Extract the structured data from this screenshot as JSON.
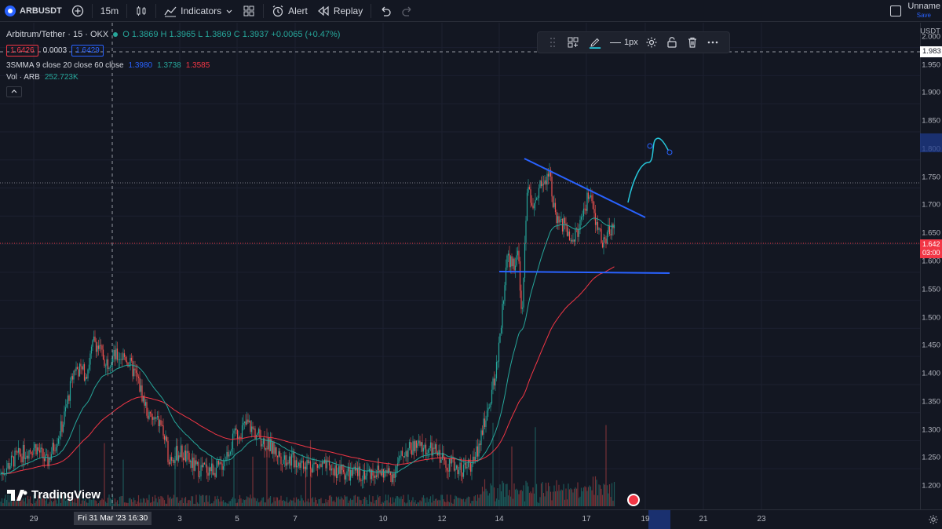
{
  "toolbar": {
    "symbol": "ARBUSDT",
    "interval": "15m",
    "indicators_label": "Indicators",
    "alert_label": "Alert",
    "replay_label": "Replay",
    "layout_name": "Unname",
    "layout_save": "Save"
  },
  "legend": {
    "title": "Arbitrum/Tether · 15 · OKX",
    "ohlc": "O 1.3869 H 1.3965 L 1.3869 C 1.3937 +0.0065 (+0.47%)",
    "bid": "1.6426",
    "spread": "0.0003",
    "ask": "1.6429",
    "ma_name": "3SMMA 9 close 20 close 60 close",
    "ma_val1": "1.3980",
    "ma_val2": "1.3738",
    "ma_val3": "1.3585",
    "vol_name": "Vol · ARB",
    "vol_value": "252.723K"
  },
  "draw_toolbar": {
    "width_label": "1px"
  },
  "price_axis": {
    "currency": "USDT",
    "labels": [
      "2.000",
      "1.950",
      "1.900",
      "1.850",
      "1.800",
      "1.750",
      "1.700",
      "1.650",
      "1.600",
      "1.550",
      "1.500",
      "1.450",
      "1.400",
      "1.350",
      "1.300",
      "1.250",
      "1.200"
    ],
    "crosshair_price": "1.983",
    "current_price": "1.642",
    "countdown": "03:00"
  },
  "time_axis": {
    "labels": [
      "29",
      "3",
      "5",
      "7",
      "10",
      "12",
      "14",
      "17",
      "19",
      "21",
      "23"
    ],
    "crosshair_time": "Fri 31 Mar '23   16:30"
  },
  "colors": {
    "background": "#131722",
    "up": "#26a69a",
    "down": "#ef5350",
    "trendline": "#2962ff",
    "projection": "#26c6da",
    "ma_red": "#f23645"
  },
  "branding": "TradingView"
}
